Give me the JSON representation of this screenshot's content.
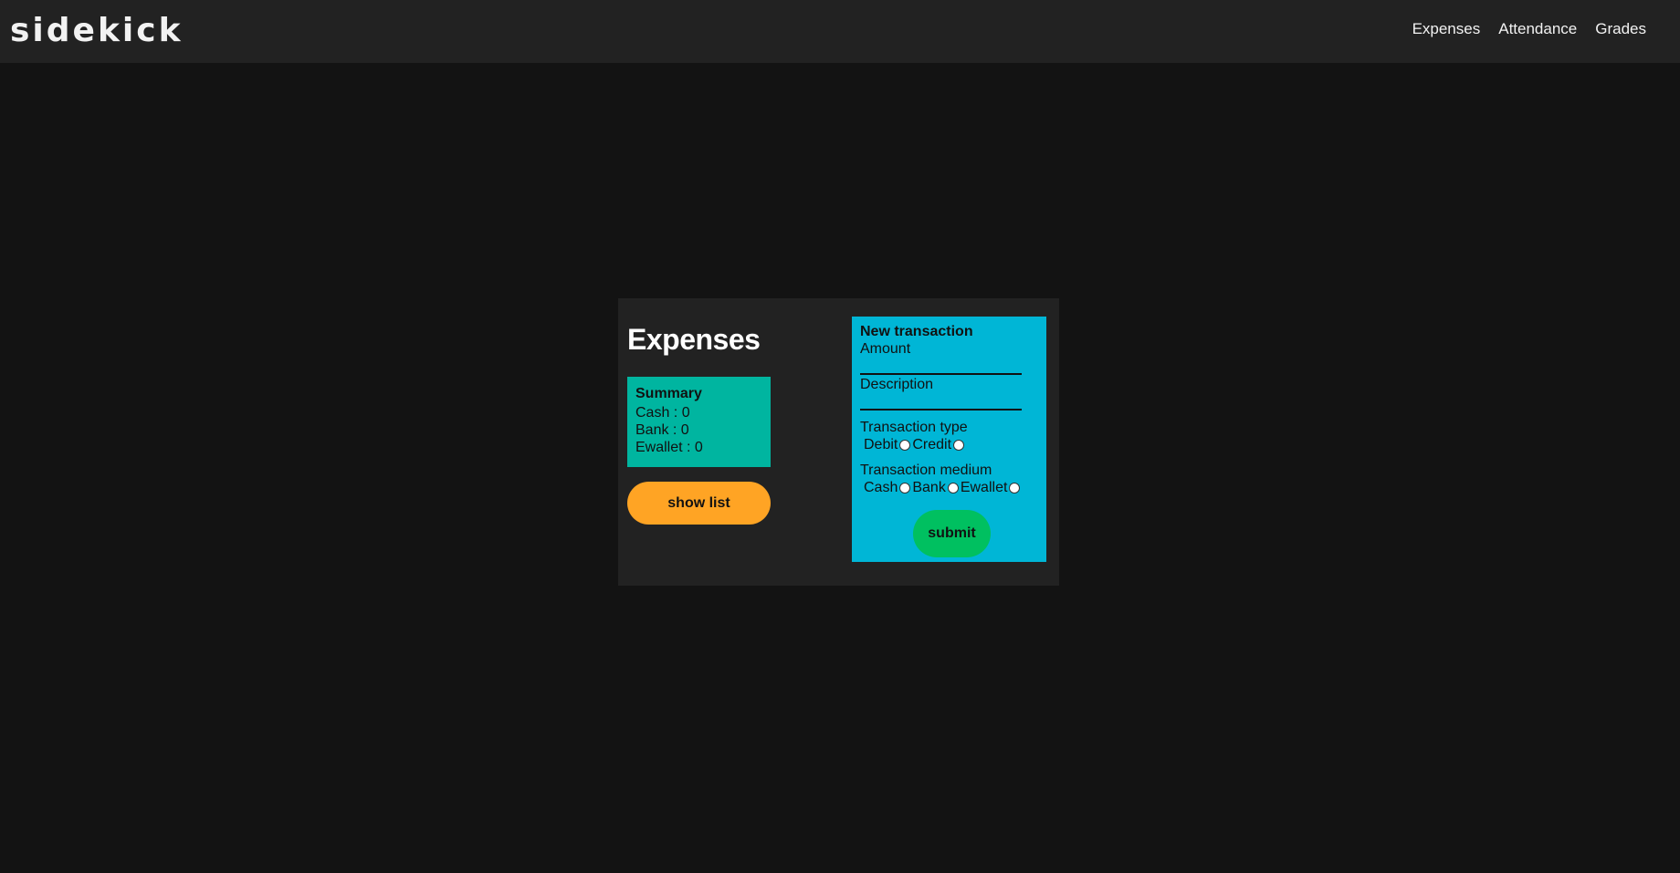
{
  "app": {
    "brand": "sidekick"
  },
  "nav": {
    "items": [
      "Expenses",
      "Attendance",
      "Grades"
    ]
  },
  "main": {
    "title": "Expenses",
    "summary": {
      "title": "Summary",
      "cash": "Cash : 0",
      "bank": "Bank : 0",
      "ewallet": "Ewallet : 0"
    },
    "show_list_label": "show list"
  },
  "transaction": {
    "title": "New transaction",
    "amount_label": "Amount",
    "amount_value": "",
    "description_label": "Description",
    "description_value": "",
    "type_label": "Transaction type",
    "type_options": [
      "Debit",
      "Credit"
    ],
    "medium_label": "Transaction medium",
    "medium_options": [
      "Cash",
      "Bank",
      "Ewallet"
    ],
    "submit_label": "submit"
  },
  "colors": {
    "page_bg": "#131313",
    "panel_bg": "#222222",
    "summary_bg": "#00b5a0",
    "form_bg": "#00b6d6",
    "show_list_bg": "#ffa424",
    "submit_bg": "#00c060"
  }
}
